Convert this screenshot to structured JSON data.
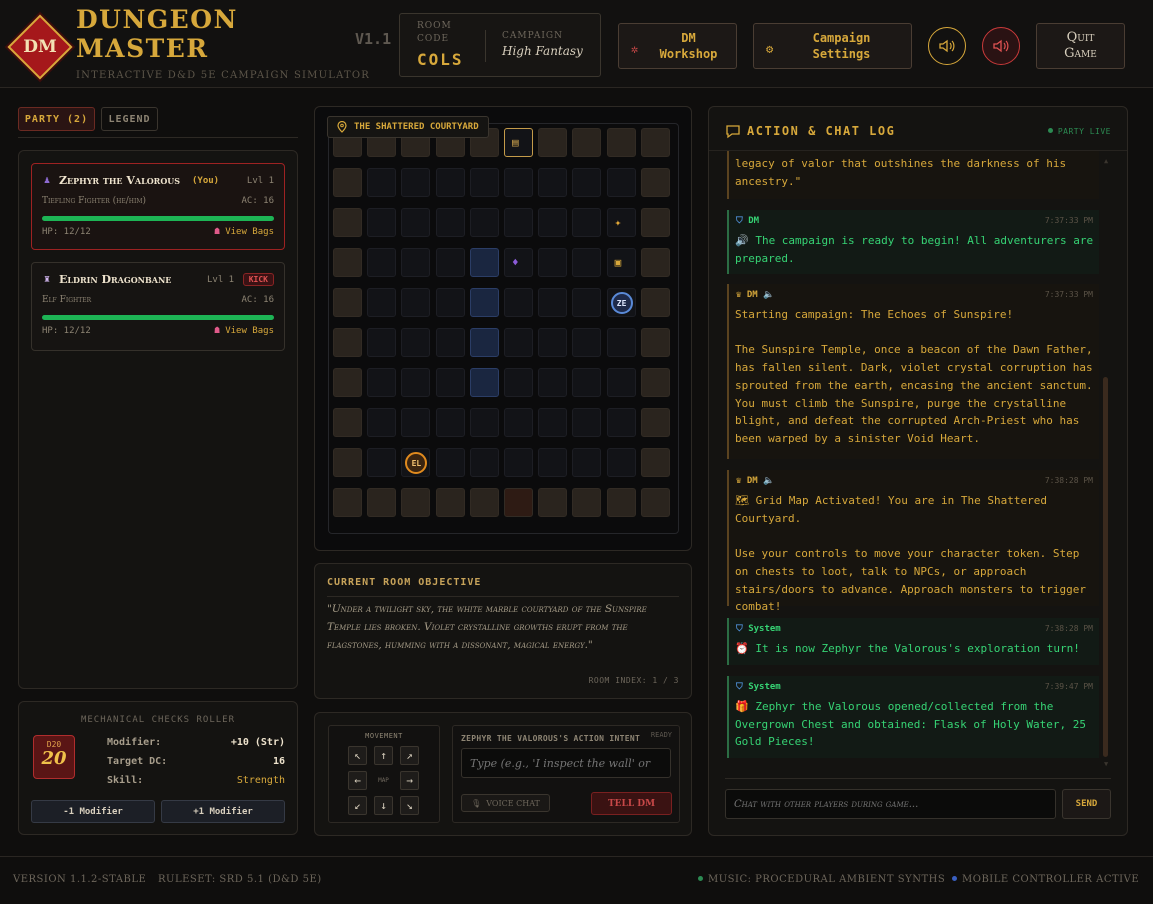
{
  "header": {
    "logo": "DM",
    "title_line1": "DUNGEON",
    "title_line2": "MASTER",
    "subtitle": "INTERACTIVE D&D 5E CAMPAIGN SIMULATOR",
    "version": "V1.1",
    "room_code_label_1": "ROOM",
    "room_code_label_2": "CODE",
    "room_code": "COLS",
    "campaign_label": "CAMPAIGN",
    "campaign_value": "High Fantasy",
    "dm_workshop_1": "DM",
    "dm_workshop_2": "Workshop",
    "campaign_settings_1": "Campaign",
    "campaign_settings_2": "Settings",
    "quit_1": "Quit",
    "quit_2": "Game"
  },
  "party": {
    "tab_party": "PARTY (2)",
    "tab_legend": "LEGEND",
    "members": [
      {
        "name": "Zephyr the Valorous",
        "you": "(You)",
        "level": "Lvl 1",
        "class": "Tiefling Fighter (he/him)",
        "ac": "AC: 16",
        "hp": "HP: 12/12",
        "hp_fraction": 1.0,
        "bags": "View Bags"
      },
      {
        "name": "Eldrin Dragonbane",
        "level": "Lvl 1",
        "kick": "KICK",
        "class": "Elf Fighter",
        "ac": "AC: 16",
        "hp": "HP: 12/12",
        "hp_fraction": 1.0,
        "bags": "View Bags"
      }
    ]
  },
  "roller": {
    "title": "MECHANICAL CHECKS ROLLER",
    "die_label": "D20",
    "die_value": "20",
    "modifier_label": "Modifier:",
    "modifier_value": "+10 (Str)",
    "target_label": "Target DC:",
    "target_value": "16",
    "skill_label": "Skill:",
    "skill_value": "Strength",
    "minus_btn": "-1 Modifier",
    "plus_btn": "+1 Modifier"
  },
  "map": {
    "location": "THE SHATTERED COURTYARD",
    "tokens": {
      "zephyr": "ZE",
      "eldrin": "EL"
    }
  },
  "objective": {
    "title": "CURRENT ROOM OBJECTIVE",
    "text": "\"Under a twilight sky, the white marble courtyard of the Sunspire Temple lies broken. Violet crystalline growths erupt from the flagstones, humming with a dissonant, magical energy.\"",
    "room_index": "ROOM INDEX: 1 / 3"
  },
  "controls": {
    "movement_label": "MOVEMENT",
    "map_label": "MAP",
    "intent_label": "ZEPHYR THE VALOROUS'S ACTION INTENT",
    "ready": "READY",
    "intent_placeholder": "Type (e.g., 'I inspect the wall' or",
    "voice_chat": "VOICE CHAT",
    "tell_dm": "TELL DM"
  },
  "chat": {
    "title": "ACTION & CHAT LOG",
    "live": "PARTY LIVE",
    "messages": [
      {
        "text": "legacy of valor that outshines the darkness of his ancestry.\""
      },
      {
        "who": "DM",
        "time": "7:37:33 PM",
        "text": "🔊 The campaign is ready to begin! All adventurers are prepared."
      },
      {
        "who": "DM",
        "time": "7:37:33 PM",
        "text": "Starting campaign: The Echoes of Sunspire!\n\nThe Sunspire Temple, once a beacon of the Dawn Father, has fallen silent. Dark, violet crystal corruption has sprouted from the earth, encasing the ancient sanctum. You must climb the Sunspire, purge the crystalline blight, and defeat the corrupted Arch-Priest who has been warped by a sinister Void Heart."
      },
      {
        "who": "DM",
        "time": "7:38:28 PM",
        "text": "🗺 Grid Map Activated! You are in The Shattered Courtyard.\n\nUse your controls to move your character token. Step on chests to loot, talk to NPCs, or approach stairs/doors to advance. Approach monsters to trigger combat!"
      },
      {
        "who": "System",
        "time": "7:38:28 PM",
        "text": "⏰ It is now Zephyr the Valorous's exploration turn!"
      },
      {
        "who": "System",
        "time": "7:39:47 PM",
        "text": "🎁 Zephyr the Valorous opened/collected from the Overgrown Chest and obtained: Flask of Holy Water, 25 Gold Pieces!"
      }
    ],
    "input_placeholder": "Chat with other players during game...",
    "send": "SEND"
  },
  "footer": {
    "version": "VERSION 1.1.2-STABLE",
    "ruleset": "RULESET: SRD 5.1 (D&D 5E)",
    "music": "MUSIC: PROCEDURAL AMBIENT SYNTHS",
    "mobile": "MOBILE CONTROLLER ACTIVE"
  },
  "colors": {
    "gold": "#d7a83b",
    "red": "#a5181b",
    "green": "#36d374",
    "bg": "#0f0e0d"
  }
}
